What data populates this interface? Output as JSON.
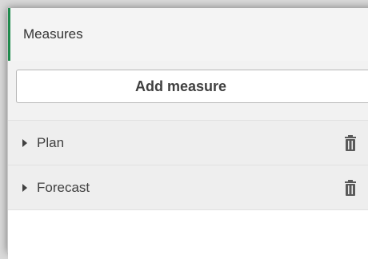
{
  "measures_panel": {
    "title": "Measures",
    "add_button_label": "Add measure",
    "items": [
      {
        "label": "Plan",
        "icon": "trash-icon"
      },
      {
        "label": "Forecast",
        "icon": "trash-icon"
      }
    ],
    "accent_color": "#1f8a4c"
  }
}
